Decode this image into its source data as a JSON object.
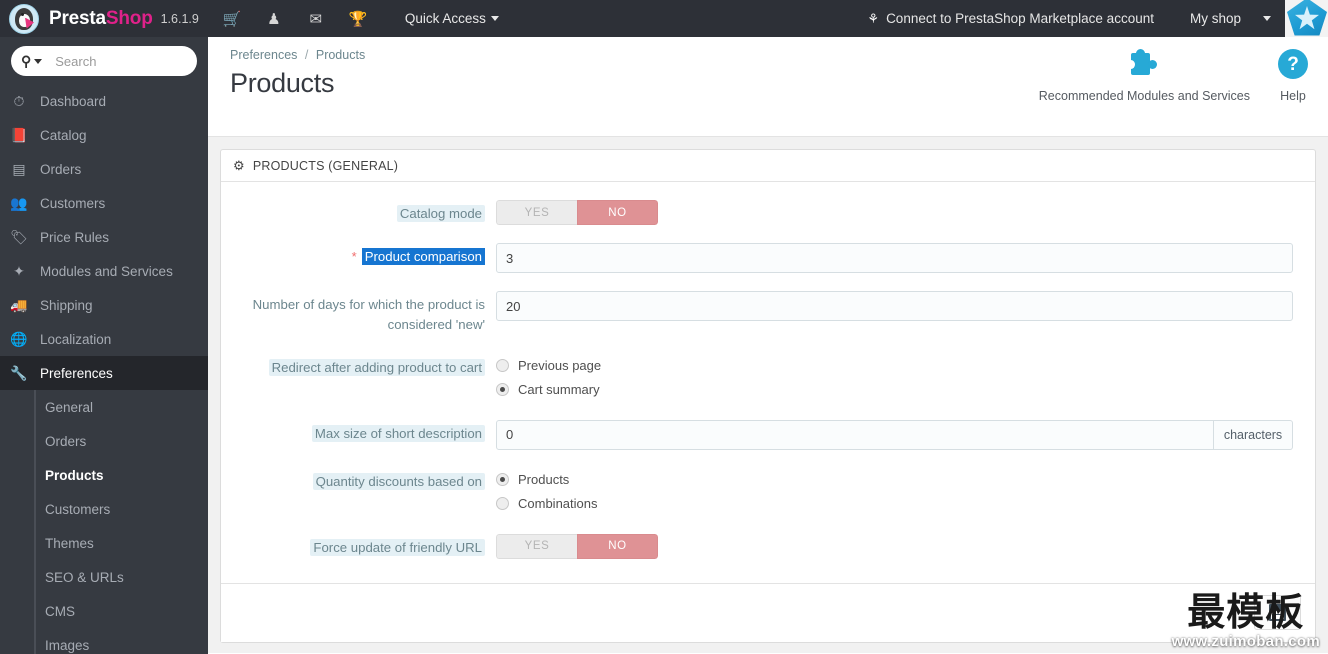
{
  "topbar": {
    "brand_presta": "Presta",
    "brand_shop": "Shop",
    "version": "1.6.1.9",
    "icons": [
      {
        "name": "cart-icon",
        "glyph": "🛒"
      },
      {
        "name": "customers-icon",
        "glyph": "♟"
      },
      {
        "name": "mail-icon",
        "glyph": "✉"
      },
      {
        "name": "trophy-icon",
        "glyph": "🏆"
      }
    ],
    "quick_access": "Quick Access",
    "marketplace": "Connect to PrestaShop Marketplace account",
    "marketplace_icon": "⚘",
    "my_shop": "My shop"
  },
  "sidebar": {
    "search_placeholder": "Search",
    "search_value": "",
    "items": [
      {
        "label": "Dashboard",
        "icon": "⏱"
      },
      {
        "label": "Catalog",
        "icon": "📕"
      },
      {
        "label": "Orders",
        "icon": "▤"
      },
      {
        "label": "Customers",
        "icon": "👥"
      },
      {
        "label": "Price Rules",
        "icon": "🏷"
      },
      {
        "label": "Modules and Services",
        "icon": "✦"
      },
      {
        "label": "Shipping",
        "icon": "🚚"
      },
      {
        "label": "Localization",
        "icon": "🌐"
      },
      {
        "label": "Preferences",
        "icon": "🔧"
      }
    ],
    "submenu": [
      {
        "label": "General"
      },
      {
        "label": "Orders"
      },
      {
        "label": "Products"
      },
      {
        "label": "Customers"
      },
      {
        "label": "Themes"
      },
      {
        "label": "SEO & URLs"
      },
      {
        "label": "CMS"
      },
      {
        "label": "Images"
      }
    ]
  },
  "page": {
    "breadcrumb_parent": "Preferences",
    "breadcrumb_sep": "/",
    "breadcrumb_current": "Products",
    "title": "Products",
    "action_modules": "Recommended Modules and Services",
    "action_help": "Help",
    "help_glyph": "?"
  },
  "panel": {
    "header": "PRODUCTS (GENERAL)",
    "header_icon": "⚙"
  },
  "form": {
    "catalog_mode": {
      "label": "Catalog mode",
      "yes": "YES",
      "no": "NO",
      "value": "NO"
    },
    "product_comparison": {
      "label": "Product comparison",
      "required_star": "*",
      "value": "3"
    },
    "new_days": {
      "label": "Number of days for which the product is considered 'new'",
      "value": "20"
    },
    "redirect_after_add": {
      "label": "Redirect after adding product to cart",
      "options": [
        "Previous page",
        "Cart summary"
      ],
      "selected": "Cart summary"
    },
    "max_short_desc": {
      "label": "Max size of short description",
      "value": "0",
      "addon": "characters"
    },
    "quantity_discounts": {
      "label": "Quantity discounts based on",
      "options": [
        "Products",
        "Combinations"
      ],
      "selected": "Products"
    },
    "force_friendly_url": {
      "label": "Force update of friendly URL",
      "yes": "YES",
      "no": "NO",
      "value": "NO"
    }
  },
  "footer": {
    "save_icon": "save-icon"
  },
  "watermark": {
    "cn": "最模板",
    "url": "www.zuimoban.com"
  },
  "colors": {
    "topbar_bg": "#2d3037",
    "sidebar_bg": "#363a41",
    "brand_pink": "#e0218a",
    "accent_blue": "#27a9d6",
    "switch_no": "#df9295",
    "label_blue": "#6c868e",
    "label_bg": "#e4f0f5",
    "selection_blue": "#1675d1"
  }
}
